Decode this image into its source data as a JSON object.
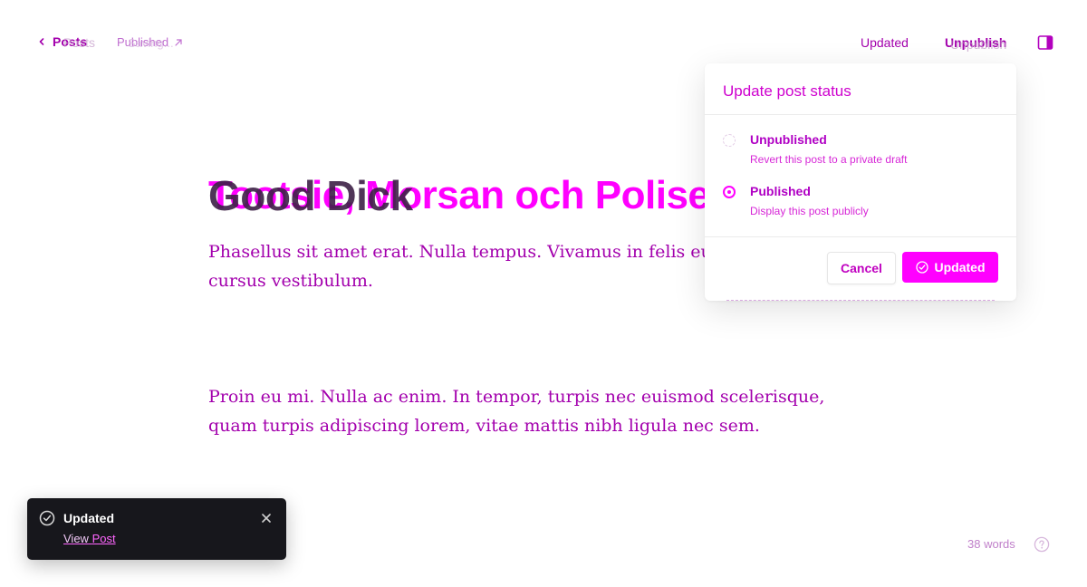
{
  "topbar": {
    "back_label": "Posts",
    "back_ghost": "Posts",
    "status_text": "Published",
    "status_ghost": "Saving...",
    "updated_label": "Updated",
    "unpublish_label": "Unpublish",
    "unpublish_ghost": "Unpublish"
  },
  "editor": {
    "title": "Tootsie, Morsan och Polise",
    "title_overlay": "Good Dick",
    "paragraph_1": "Phasellus sit amet erat. Nulla tempus. Vivamus in felis eu sapien cursus vestibulum.",
    "paragraph_2": "Proin eu mi. Nulla ac enim. In tempor, turpis nec euismod scelerisque, quam turpis adipiscing lorem, vitae mattis nibh ligula nec sem."
  },
  "popover": {
    "title": "Update post status",
    "options": [
      {
        "label": "Unpublished",
        "description": "Revert this post to a private draft",
        "selected": false
      },
      {
        "label": "Published",
        "description": "Display this post publicly",
        "selected": true
      }
    ],
    "cancel_label": "Cancel",
    "update_label": "Updated"
  },
  "toast": {
    "title": "Updated",
    "link_first": "View",
    "link_second": "Post"
  },
  "footer": {
    "word_count_number": "38",
    "word_count_unit": "words"
  },
  "colors": {
    "accent": "#ff00ff",
    "text_purple": "#a300ad",
    "toast_bg": "#17171c"
  }
}
